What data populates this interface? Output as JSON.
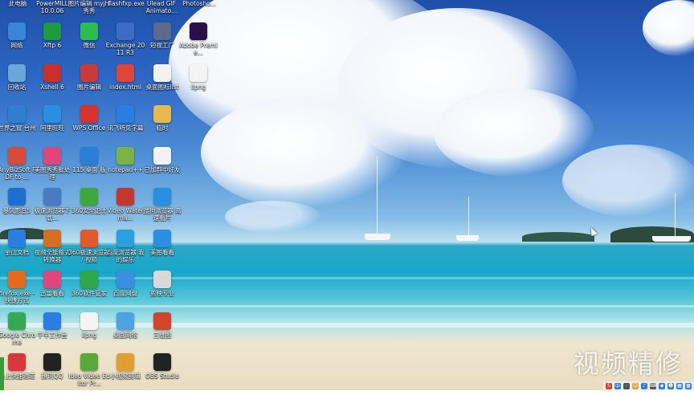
{
  "top_labels": [
    "此电脑",
    "PowerMILL 10.0.06",
    "图片编辑 myjhl秀秀",
    "flashfxp.exe",
    "Ulead GIF Animato...",
    "Photosho..."
  ],
  "icons": [
    {
      "label": "网络",
      "icon": "network-icon",
      "color": "#3a86d6"
    },
    {
      "label": "回收站",
      "icon": "recycle-bin-icon",
      "color": "#6aa6d8"
    },
    {
      "label": "世界之窗 台州",
      "icon": "globe-icon",
      "color": "#2f7fd0"
    },
    {
      "label": "AnyBizSoft PDF to ...",
      "icon": "pdf-converter-icon",
      "color": "#d84b3a"
    },
    {
      "label": "暴风影音5",
      "icon": "baofeng-icon",
      "color": "#1e6fcf"
    },
    {
      "label": "金山文档",
      "icon": "kingsoft-docs-icon",
      "color": "#2a7de1"
    },
    {
      "label": "firefox.exe - 快捷方式",
      "icon": "firefox-icon",
      "color": "#e66a1c"
    },
    {
      "label": "Google Chrome",
      "icon": "chrome-icon",
      "color": "#34a853"
    },
    {
      "label": "云上快速通道",
      "icon": "cloud-icon",
      "color": "#d9373a"
    },
    {
      "label": "Xftp 6",
      "icon": "xftp-icon",
      "color": "#1f9a3f"
    },
    {
      "label": "Xshell 6",
      "icon": "xshell-icon",
      "color": "#c9302c"
    },
    {
      "label": "阿里旺旺",
      "icon": "aliwangwang-icon",
      "color": "#2a8fe0"
    },
    {
      "label": "美图秀秀批处理",
      "icon": "meitu-batch-icon",
      "color": "#e0457b"
    },
    {
      "label": "极速浏览器下载...",
      "icon": "browser-download-icon",
      "color": "#4b7ac2"
    },
    {
      "label": "视频全能格式转换器",
      "icon": "video-convert-icon",
      "color": "#d2701f"
    },
    {
      "label": "迅雷看看",
      "icon": "xunlei-icon",
      "color": "#e0457b"
    },
    {
      "label": "千牛工作台",
      "icon": "qianniu-icon",
      "color": "#2a7de1"
    },
    {
      "label": "腾讯QQ",
      "icon": "qq-icon",
      "color": "#222222"
    },
    {
      "label": "微信",
      "icon": "wechat-icon",
      "color": "#2dbd4e"
    },
    {
      "label": "图片编辑",
      "icon": "image-edit-icon",
      "color": "#c83b3b"
    },
    {
      "label": "WPS Office",
      "icon": "wps-icon",
      "color": "#d6332b"
    },
    {
      "label": "115 桌面 版",
      "icon": "115-icon",
      "color": "#2b7ed6"
    },
    {
      "label": "360安全卫士",
      "icon": "360-safe-icon",
      "color": "#3fa83a"
    },
    {
      "label": "360极速浏览器 / 视频",
      "icon": "360-browser-icon",
      "color": "#e15a2e"
    },
    {
      "label": "360软件管家",
      "icon": "360-manager-icon",
      "color": "#2fa84a"
    },
    {
      "label": "Ilpng",
      "icon": "image-file-icon",
      "color": "#f4f4f4"
    },
    {
      "label": "Ideo Video Editor Pr...",
      "icon": "video-editor-icon",
      "color": "#5aa83a"
    },
    {
      "label": "Exchange 2011 R3",
      "icon": "exchange-icon",
      "color": "#3b6cc6"
    },
    {
      "label": "index.html",
      "icon": "html-file-icon",
      "color": "#e1453a"
    },
    {
      "label": "讯飞听见字幕",
      "icon": "iflytek-icon",
      "color": "#2a7de1"
    },
    {
      "label": "notepad++",
      "icon": "notepad-icon",
      "color": "#7cb342"
    },
    {
      "label": "Video Waterma...",
      "icon": "video-watermark-icon",
      "color": "#c0392b"
    },
    {
      "label": "百度浏览器 我的娱乐",
      "icon": "baidu-browser-icon",
      "color": "#2ba0e0"
    },
    {
      "label": "百度网盘",
      "icon": "baidu-netdisk-icon",
      "color": "#3b8fe0"
    },
    {
      "label": "桌面网络",
      "icon": "desktop-network-icon",
      "color": "#4ba3e2"
    },
    {
      "label": "小视频剪辑",
      "icon": "video-clip-icon",
      "color": "#e0a030"
    },
    {
      "label": "短视工厂",
      "icon": "video-factory-icon",
      "color": "#5a6b8c"
    },
    {
      "label": "桌面图标list",
      "icon": "text-file-icon",
      "color": "#f2f2f2"
    },
    {
      "label": "临时",
      "icon": "folder-icon",
      "color": "#e8b84a"
    },
    {
      "label": "已加群中好友",
      "icon": "document-icon",
      "color": "#f2f2f2"
    },
    {
      "label": "搜狗浏览器 高速看片",
      "icon": "sogou-browser-icon",
      "color": "#2a8fe0"
    },
    {
      "label": "美图看看",
      "icon": "meitu-viewer-icon",
      "color": "#2a8fe0"
    },
    {
      "label": "剪映专业",
      "icon": "capcut-icon",
      "color": "#d9d9d9"
    },
    {
      "label": "三维图",
      "icon": "3d-icon",
      "color": "#d3452a"
    },
    {
      "label": "OBS Studio",
      "icon": "obs-icon",
      "color": "#222222"
    },
    {
      "label": "Adobe Premie...",
      "icon": "premiere-icon",
      "color": "#2a0f4a"
    },
    {
      "label": "Ilpng",
      "icon": "png-file-icon",
      "color": "#f4f4f4"
    }
  ],
  "watermark": "视频精修",
  "tray": [
    {
      "name": "sogou-input-icon",
      "glyph": "S",
      "color": "#e13a2a"
    },
    {
      "name": "ime-zh-icon",
      "glyph": "中",
      "color": "#2a7de1"
    },
    {
      "name": "punctuation-icon",
      "glyph": "·",
      "color": "#555555"
    },
    {
      "name": "emoji-icon",
      "glyph": "☺",
      "color": "#e0a030"
    },
    {
      "name": "microphone-icon",
      "glyph": "♪",
      "color": "#2a7de1"
    },
    {
      "name": "keyboard-icon",
      "glyph": "⌨",
      "color": "#555555"
    },
    {
      "name": "skin-icon",
      "glyph": "◆",
      "color": "#2a7de1"
    },
    {
      "name": "user-icon",
      "glyph": "☻",
      "color": "#2a7de1"
    },
    {
      "name": "clothes-icon",
      "glyph": "▦",
      "color": "#2a7de1"
    },
    {
      "name": "grid-icon",
      "glyph": "▩",
      "color": "#2a7de1"
    }
  ]
}
